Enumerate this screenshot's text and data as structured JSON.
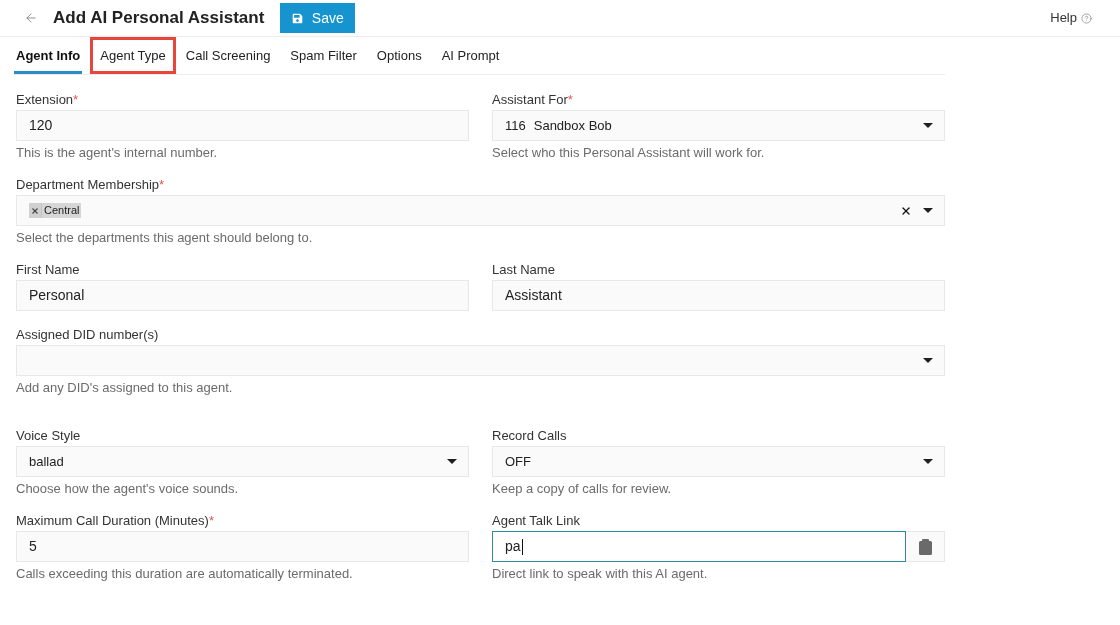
{
  "header": {
    "title": "Add AI Personal Assistant",
    "save_label": "Save",
    "help_label": "Help"
  },
  "tabs": [
    {
      "label": "Agent Info",
      "selected": true,
      "highlighted": false
    },
    {
      "label": "Agent Type",
      "selected": false,
      "highlighted": true
    },
    {
      "label": "Call Screening",
      "selected": false,
      "highlighted": false
    },
    {
      "label": "Spam Filter",
      "selected": false,
      "highlighted": false
    },
    {
      "label": "Options",
      "selected": false,
      "highlighted": false
    },
    {
      "label": "AI Prompt",
      "selected": false,
      "highlighted": false
    }
  ],
  "sections": [
    {
      "rows": [
        {
          "fields": [
            {
              "kind": "text",
              "label": "Extension",
              "required_mark": "*",
              "value": "120",
              "focused": false,
              "helper": "This is the agent's internal number."
            },
            {
              "kind": "select",
              "label": "Assistant For",
              "required_mark": "*",
              "prefix": "116",
              "value": "Sandbox Bob",
              "focused": false,
              "helper": "Select who this Personal Assistant will work for."
            }
          ]
        },
        {
          "fields": [
            {
              "kind": "multiselect",
              "label": "Department Membership",
              "required_mark": "*",
              "tags": [
                "Central"
              ],
              "focused": false,
              "helper": "Select the departments this agent should belong to."
            }
          ]
        },
        {
          "fields": [
            {
              "kind": "text",
              "label": "First Name",
              "value": "Personal",
              "focused": false
            },
            {
              "kind": "text",
              "label": "Last Name",
              "value": "Assistant",
              "focused": false
            }
          ]
        },
        {
          "fields": [
            {
              "kind": "select",
              "label": "Assigned DID number(s)",
              "focused": false,
              "helper": "Add any DID's assigned to this agent."
            }
          ]
        }
      ]
    },
    {
      "rows": [
        {
          "fields": [
            {
              "kind": "select",
              "label": "Voice Style",
              "value": "ballad",
              "focused": false,
              "helper": "Choose how the agent's voice sounds."
            },
            {
              "kind": "select",
              "label": "Record Calls",
              "value": "OFF",
              "focused": false,
              "helper": "Keep a copy of calls for review."
            }
          ]
        },
        {
          "fields": [
            {
              "kind": "text",
              "label": "Maximum Call Duration (Minutes)",
              "required_mark": "*",
              "value": "5",
              "focused": false,
              "helper": "Calls exceeding this duration are automatically terminated."
            },
            {
              "kind": "link",
              "label": "Agent Talk Link",
              "value": "pa",
              "focused": true,
              "helper": "Direct link to speak with this AI agent."
            }
          ]
        }
      ]
    }
  ]
}
